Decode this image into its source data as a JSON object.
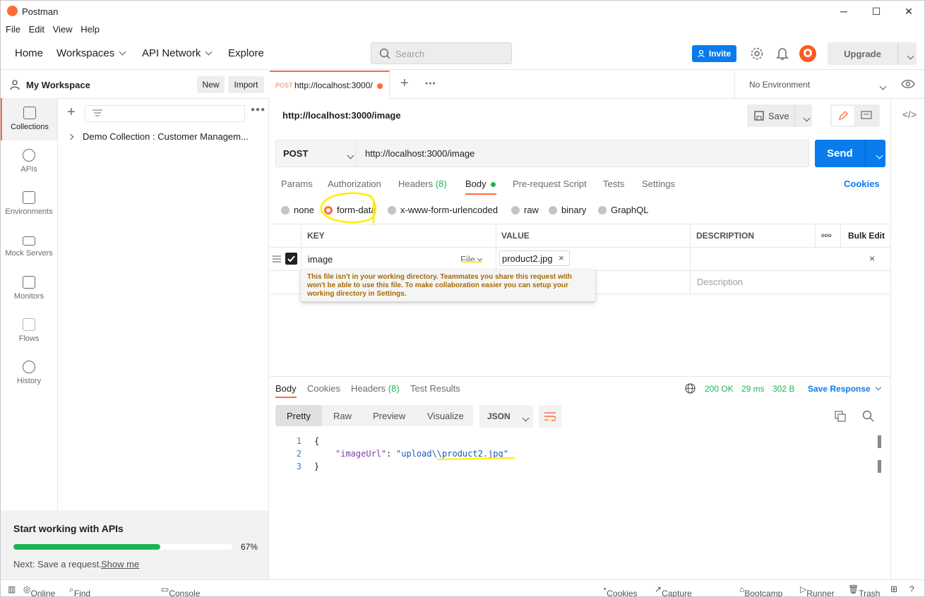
{
  "window": {
    "title": "Postman",
    "minimize": "─",
    "maximize": "☐",
    "close": "✕"
  },
  "menu": [
    "File",
    "Edit",
    "View",
    "Help"
  ],
  "nav": {
    "home": "Home",
    "workspaces": "Workspaces",
    "api_network": "API Network",
    "explore": "Explore"
  },
  "search": {
    "placeholder": "Search"
  },
  "header": {
    "invite": "Invite",
    "upgrade": "Upgrade"
  },
  "workspace": {
    "name": "My Workspace",
    "new": "New",
    "import": "Import"
  },
  "sidebar": {
    "items": [
      {
        "label": "Collections",
        "icon": "collections-icon"
      },
      {
        "label": "APIs",
        "icon": "apis-icon"
      },
      {
        "label": "Environments",
        "icon": "environments-icon"
      },
      {
        "label": "Mock Servers",
        "icon": "mock-servers-icon"
      },
      {
        "label": "Monitors",
        "icon": "monitors-icon"
      },
      {
        "label": "Flows",
        "icon": "flows-icon"
      },
      {
        "label": "History",
        "icon": "history-icon"
      }
    ]
  },
  "collections": [
    {
      "label": "Demo Collection : Customer Managem..."
    }
  ],
  "onboarding": {
    "title": "Start working with APIs",
    "percent": "67%",
    "progress": 0.67,
    "next_text": "Next: Save a request.",
    "show_me": "Show me"
  },
  "tabs": [
    {
      "method": "POST",
      "label": "http://localhost:3000/"
    }
  ],
  "environment": {
    "selected": "No Environment"
  },
  "request": {
    "name": "http://localhost:3000/image",
    "save": "Save",
    "method": "POST",
    "url": "http://localhost:3000/image",
    "send": "Send",
    "cookies": "Cookies",
    "tabs": {
      "params": "Params",
      "authorization": "Authorization",
      "headers": "Headers",
      "headers_count": "(8)",
      "body": "Body",
      "prerequest": "Pre-request Script",
      "tests": "Tests",
      "settings": "Settings"
    },
    "body_types": [
      "none",
      "form-data",
      "x-www-form-urlencoded",
      "raw",
      "binary",
      "GraphQL"
    ],
    "table": {
      "key_header": "KEY",
      "value_header": "VALUE",
      "description_header": "DESCRIPTION",
      "more": "ooo",
      "bulk_edit": "Bulk Edit",
      "row": {
        "key": "image",
        "type": "File",
        "value": "product2.jpg"
      },
      "new_row": {
        "description_placeholder": "Description"
      }
    },
    "tooltip": "This file isn't in your working directory. Teammates you share this request with won't be able to use this file. To make collaboration easier you can setup your working directory in Settings."
  },
  "response": {
    "tabs": {
      "body": "Body",
      "cookies": "Cookies",
      "headers": "Headers",
      "headers_count": "(8)",
      "test_results": "Test Results"
    },
    "status": "200 OK",
    "time": "29 ms",
    "size": "302 B",
    "save": "Save Response",
    "views": [
      "Pretty",
      "Raw",
      "Preview",
      "Visualize"
    ],
    "format": "JSON",
    "lines": [
      {
        "n": "1",
        "text": "{"
      },
      {
        "n": "2",
        "key": "\"imageUrl\"",
        "colon": ": ",
        "value": "\"upload\\\\product2.jpg\""
      },
      {
        "n": "3",
        "text": "}"
      }
    ]
  },
  "statusbar": {
    "online": "Online",
    "find_replace": "Find and Replace",
    "console": "Console",
    "cookies": "Cookies",
    "capture": "Capture requests",
    "bootcamp": "Bootcamp",
    "runner": "Runner",
    "trash": "Trash"
  },
  "colors": {
    "accent": "#ff6c37",
    "primary": "#097bed",
    "success": "#1cb552",
    "highlight": "#ffee00"
  }
}
